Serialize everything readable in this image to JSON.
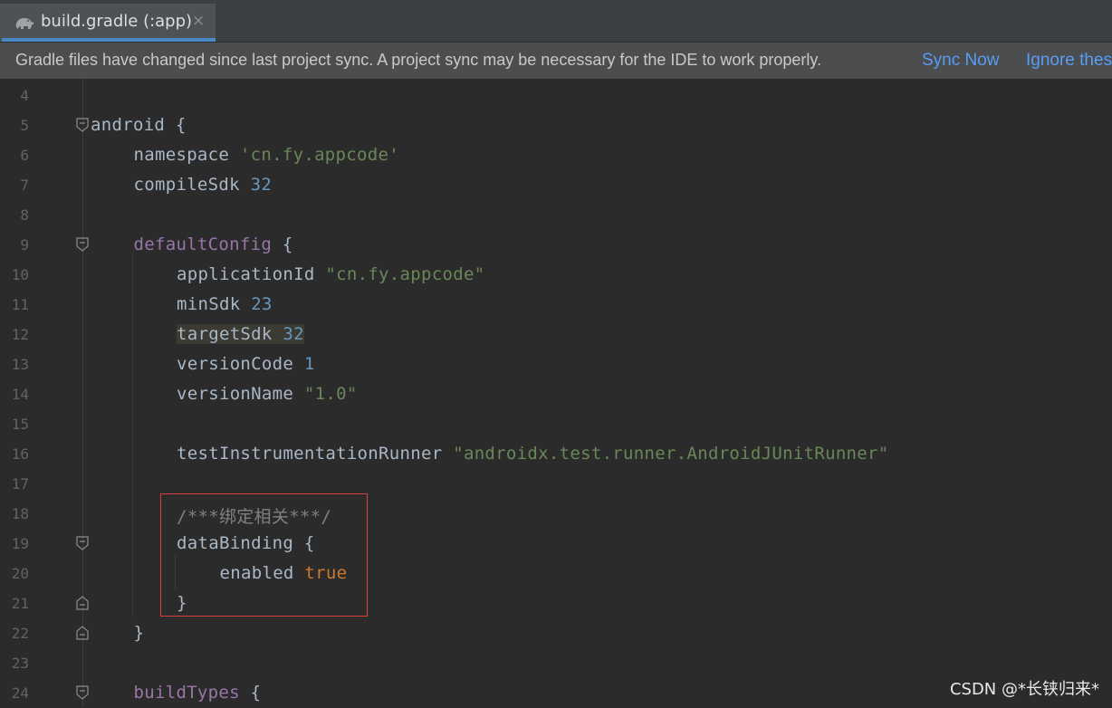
{
  "tab": {
    "title": "build.gradle (:app)",
    "close_glyph": "×",
    "icon": "gradle-elephant-icon"
  },
  "banner": {
    "message": "Gradle files have changed since last project sync. A project sync may be necessary for the IDE to work properly.",
    "sync_now": "Sync Now",
    "ignore": "Ignore thes"
  },
  "code_lines": [
    {
      "num": "4"
    },
    {
      "num": "5",
      "a": "android",
      "b": " {"
    },
    {
      "num": "6",
      "a": "namespace ",
      "s": "'cn.fy.appcode'"
    },
    {
      "num": "7",
      "a": "compileSdk ",
      "n": "32"
    },
    {
      "num": "8"
    },
    {
      "num": "9",
      "p": "defaultConfig",
      "b": " {"
    },
    {
      "num": "10",
      "a": "applicationId ",
      "s": "\"cn.fy.appcode\""
    },
    {
      "num": "11",
      "a": "minSdk ",
      "n": "23"
    },
    {
      "num": "12",
      "a": "targetSdk ",
      "n": "32"
    },
    {
      "num": "13",
      "a": "versionCode ",
      "n": "1"
    },
    {
      "num": "14",
      "a": "versionName ",
      "s": "\"1.0\""
    },
    {
      "num": "15"
    },
    {
      "num": "16",
      "a": "testInstrumentationRunner ",
      "s": "\"androidx.test.runner.AndroidJUnitRunner\""
    },
    {
      "num": "17"
    },
    {
      "num": "18",
      "c": "/***绑定相关***/"
    },
    {
      "num": "19",
      "a": "dataBinding",
      "b": " {"
    },
    {
      "num": "20",
      "a": "enabled ",
      "k": "true"
    },
    {
      "num": "21",
      "a": "}"
    },
    {
      "num": "22",
      "a": "}"
    },
    {
      "num": "23"
    },
    {
      "num": "24",
      "p": "buildTypes",
      "b": " {"
    }
  ],
  "watermark": "CSDN @*长铗归来*",
  "colors": {
    "background": "#2b2b2b",
    "keyword_purple": "#9876aa",
    "number": "#6897bb",
    "string": "#6a8759",
    "keyword_orange": "#cc7832",
    "comment": "#808080",
    "link": "#589df6",
    "tab_accent": "#4a88c7",
    "highlight_box": "#d93d3d"
  }
}
